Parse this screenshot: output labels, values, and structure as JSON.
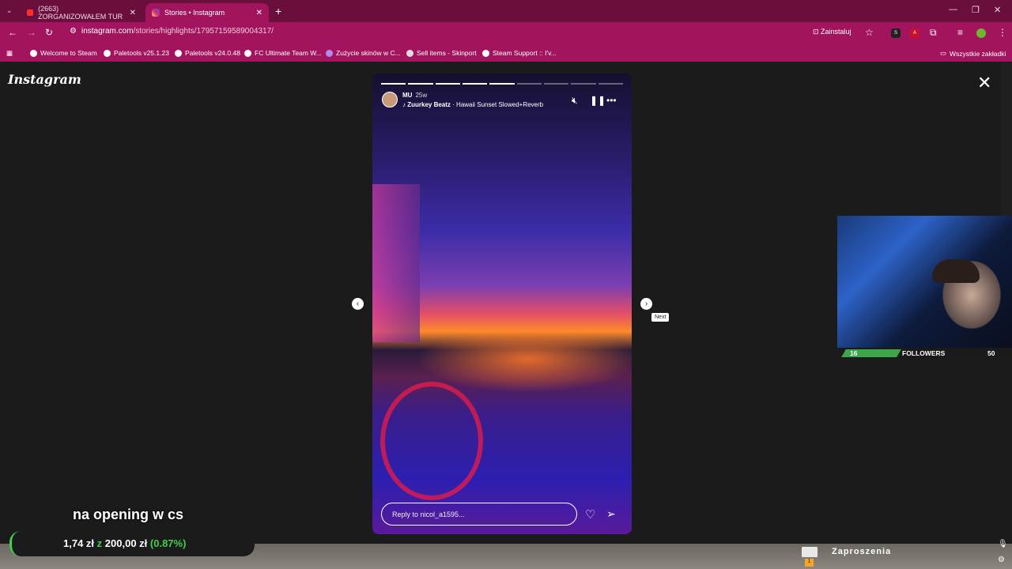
{
  "browser": {
    "tabs": [
      {
        "title": "(2663) ZORGANIZOWAŁEM TUR",
        "icon": "youtube-icon"
      },
      {
        "title": "Stories • Instagram",
        "icon": "instagram-icon"
      }
    ],
    "url_domain": "instagram.com",
    "url_path": "/stories/highlights/17957159589004317/",
    "install_label": "Zainstaluj",
    "bookmarks": [
      {
        "label": "Welcome to Steam",
        "icon": "steam-icon"
      },
      {
        "label": "Paletools v25.1.23",
        "icon": "paletools-icon"
      },
      {
        "label": "Paletools v24.0.48",
        "icon": "paletools-icon"
      },
      {
        "label": "FC Ultimate Team W...",
        "icon": "ea-icon"
      },
      {
        "label": "Zużycie skinów w C...",
        "icon": "skin-icon"
      },
      {
        "label": "Sell items - Skinport",
        "icon": "skinport-icon"
      },
      {
        "label": "Steam Support :: I'v...",
        "icon": "steam-icon"
      }
    ],
    "all_bookmarks": "Wszystkie zakładki",
    "accent_color": "#a3145e"
  },
  "instagram": {
    "logo": "Instagram",
    "story": {
      "username": "MU",
      "age": "25w",
      "music_artist": "Zuurkey Beatz",
      "music_title": "· Hawaii Sunset Slowed+Reverb",
      "progress_total": 9,
      "progress_done": 5,
      "reply_placeholder": "Reply to nicol_a1595..."
    },
    "tooltip_next": "Next"
  },
  "overlay": {
    "followers_current": "16",
    "followers_label": "FOLLOWERS",
    "followers_goal": "50",
    "followers_fraction": 0.32,
    "caption": "na opening w cs",
    "donation_current": "1,74 zł",
    "donation_sep": "z",
    "donation_goal": "200,00 zł",
    "donation_pct": "(0.87%)",
    "invites_label": "Zaproszenia",
    "invites_count": "1"
  }
}
